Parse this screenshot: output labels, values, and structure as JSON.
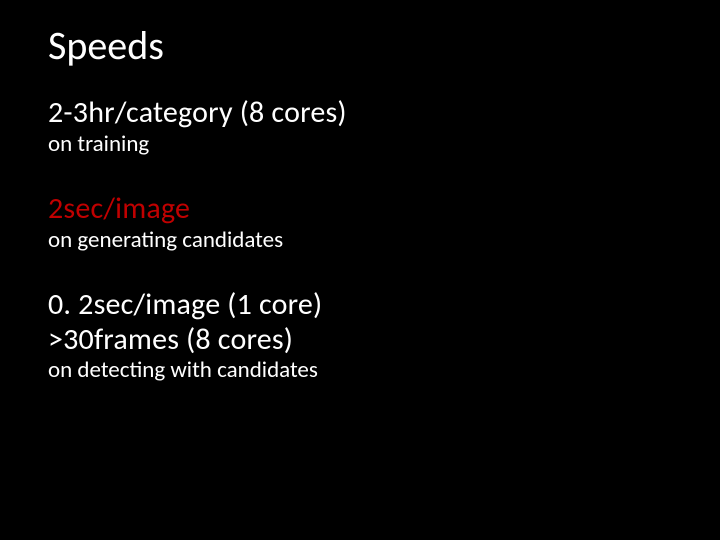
{
  "title": "Speeds",
  "blocks": [
    {
      "lines": [
        "2-3hr/category (8 cores)"
      ],
      "highlight": false,
      "sub": "on training"
    },
    {
      "lines": [
        "2sec/image"
      ],
      "highlight": true,
      "sub": "on generating candidates"
    },
    {
      "lines": [
        "0. 2sec/image (1 core)",
        ">30frames (8 cores)"
      ],
      "highlight": false,
      "sub": "on detecting with candidates"
    }
  ]
}
